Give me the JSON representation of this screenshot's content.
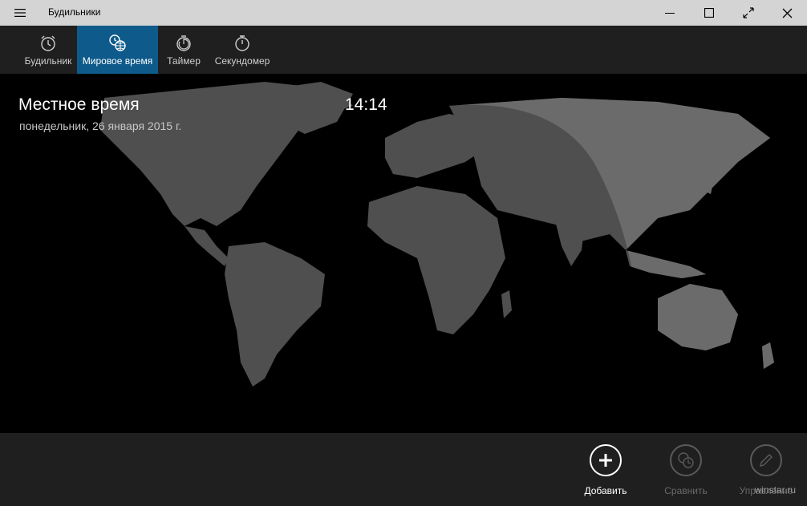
{
  "titlebar": {
    "title": "Будильники"
  },
  "nav": {
    "tabs": [
      {
        "label": "Будильник",
        "icon": "alarm-clock-icon",
        "active": false
      },
      {
        "label": "Мировое время",
        "icon": "world-clock-icon",
        "active": true
      },
      {
        "label": "Таймер",
        "icon": "timer-icon",
        "active": false
      },
      {
        "label": "Секундомер",
        "icon": "stopwatch-icon",
        "active": false
      }
    ]
  },
  "world": {
    "local_title": "Местное время",
    "local_date": "понедельник, 26 января 2015 г.",
    "local_time": "14:14"
  },
  "commands": {
    "add_label": "Добавить",
    "compare_label": "Сравнить",
    "manage_label": "Управление"
  },
  "watermark": "winstar.ru",
  "colors": {
    "accent": "#0e5a8a",
    "titlebar": "#d4d4d4",
    "bar": "#1f1f1f",
    "land_day": "#6b6b6b",
    "land_night": "#4a4a4a"
  }
}
